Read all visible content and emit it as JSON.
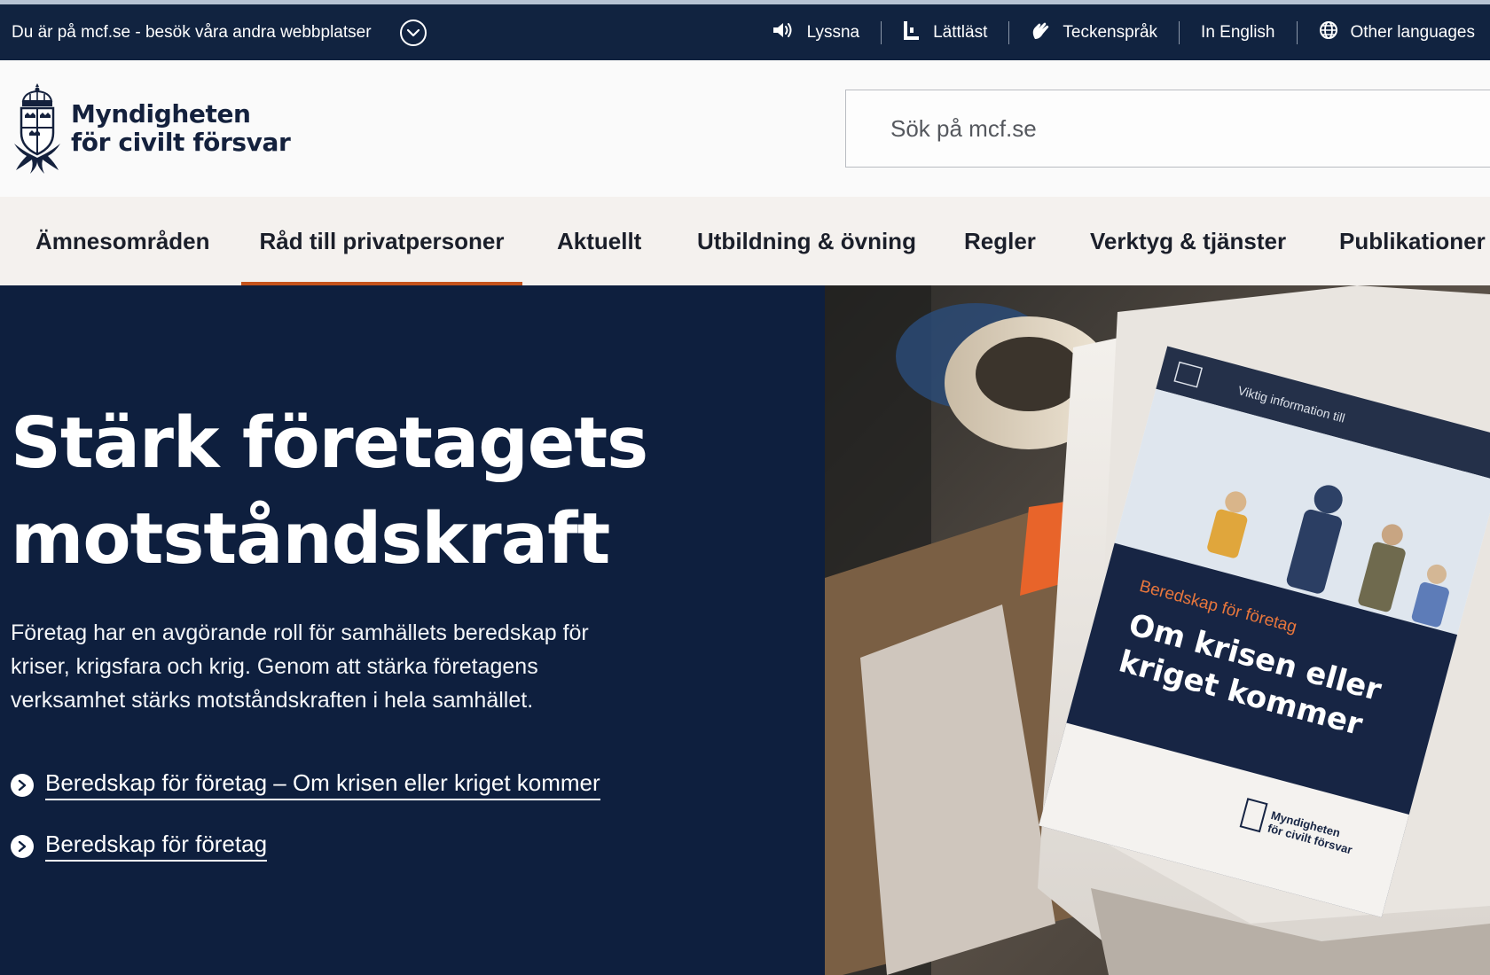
{
  "utility": {
    "notice": "Du är på mcf.se - besök våra andra webbplatser",
    "links": [
      {
        "label": "Lyssna",
        "icon": "speaker-icon"
      },
      {
        "label": "Lättläst",
        "icon": "easy-read-icon"
      },
      {
        "label": "Teckenspråk",
        "icon": "sign-language-icon"
      },
      {
        "label": "In English",
        "icon": ""
      },
      {
        "label": "Other languages",
        "icon": "globe-icon"
      }
    ]
  },
  "header": {
    "logo_line1": "Myndigheten",
    "logo_line2": "för civilt försvar",
    "search_placeholder": "Sök på mcf.se"
  },
  "nav": {
    "items": [
      {
        "label": "Ämnesområden",
        "active": false
      },
      {
        "label": "Råd till privatpersoner",
        "active": true
      },
      {
        "label": "Aktuellt",
        "active": false
      },
      {
        "label": "Utbildning & övning",
        "active": false
      },
      {
        "label": "Regler",
        "active": false
      },
      {
        "label": "Verktyg & tjänster",
        "active": false
      },
      {
        "label": "Publikationer",
        "active": false
      }
    ]
  },
  "hero": {
    "title_line1": "Stärk företagets",
    "title_line2": "motståndskraft",
    "lead": "Företag har en avgörande roll för samhällets beredskap för kriser, krigsfara och krig. Genom att stärka företagens verksamhet stärks motståndskraften i hela samhället.",
    "links": [
      "Beredskap för företag – Om krisen eller kriget kommer",
      "Beredskap för företag"
    ]
  },
  "brochure": {
    "header_text": "Viktig information till",
    "subtitle": "Beredskap för företag",
    "title_line1": "Om krisen eller",
    "title_line2": "kriget kommer",
    "logo_line1": "Myndigheten",
    "logo_line2": "för civilt försvar"
  },
  "colors": {
    "utility_bg": "#112340",
    "hero_bg": "#0e1f3e",
    "nav_bg": "#f4f1ee",
    "accent": "#c4531c",
    "brochure_accent": "#e8763c"
  }
}
